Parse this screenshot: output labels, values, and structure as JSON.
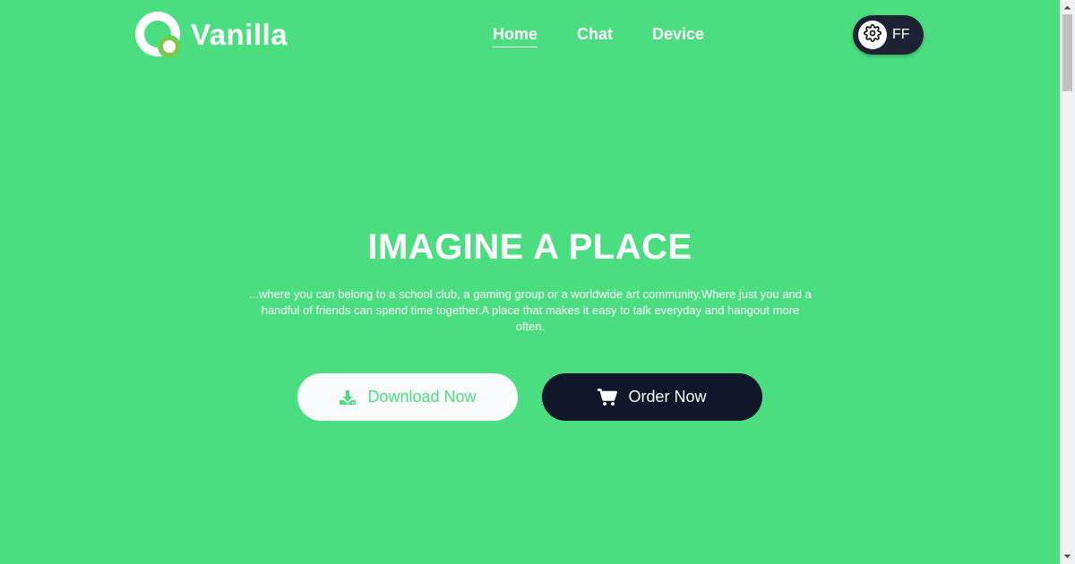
{
  "brand": {
    "name": "Vanilla",
    "logo_icon": "vanilla-logo-icon"
  },
  "nav": {
    "items": [
      {
        "label": "Home",
        "active": true
      },
      {
        "label": "Chat",
        "active": false
      },
      {
        "label": "Device",
        "active": false
      }
    ]
  },
  "theme_toggle": {
    "icon": "gear-icon",
    "label": "FF"
  },
  "hero": {
    "title": "IMAGINE A PLACE",
    "text": "...where you can belong to a school club, a gaming group or a worldwide art community.Where just you and a handful of friends can spend time together.A place that makes it easy to talk everyday and hangout more often."
  },
  "buttons": {
    "download": {
      "label": "Download Now",
      "icon": "download-icon"
    },
    "order": {
      "label": "Order Now",
      "icon": "cart-icon"
    }
  },
  "colors": {
    "background": "#4ade80",
    "dark": "#10172a",
    "light": "#f8fafc",
    "accent_text": "#4ade80"
  }
}
